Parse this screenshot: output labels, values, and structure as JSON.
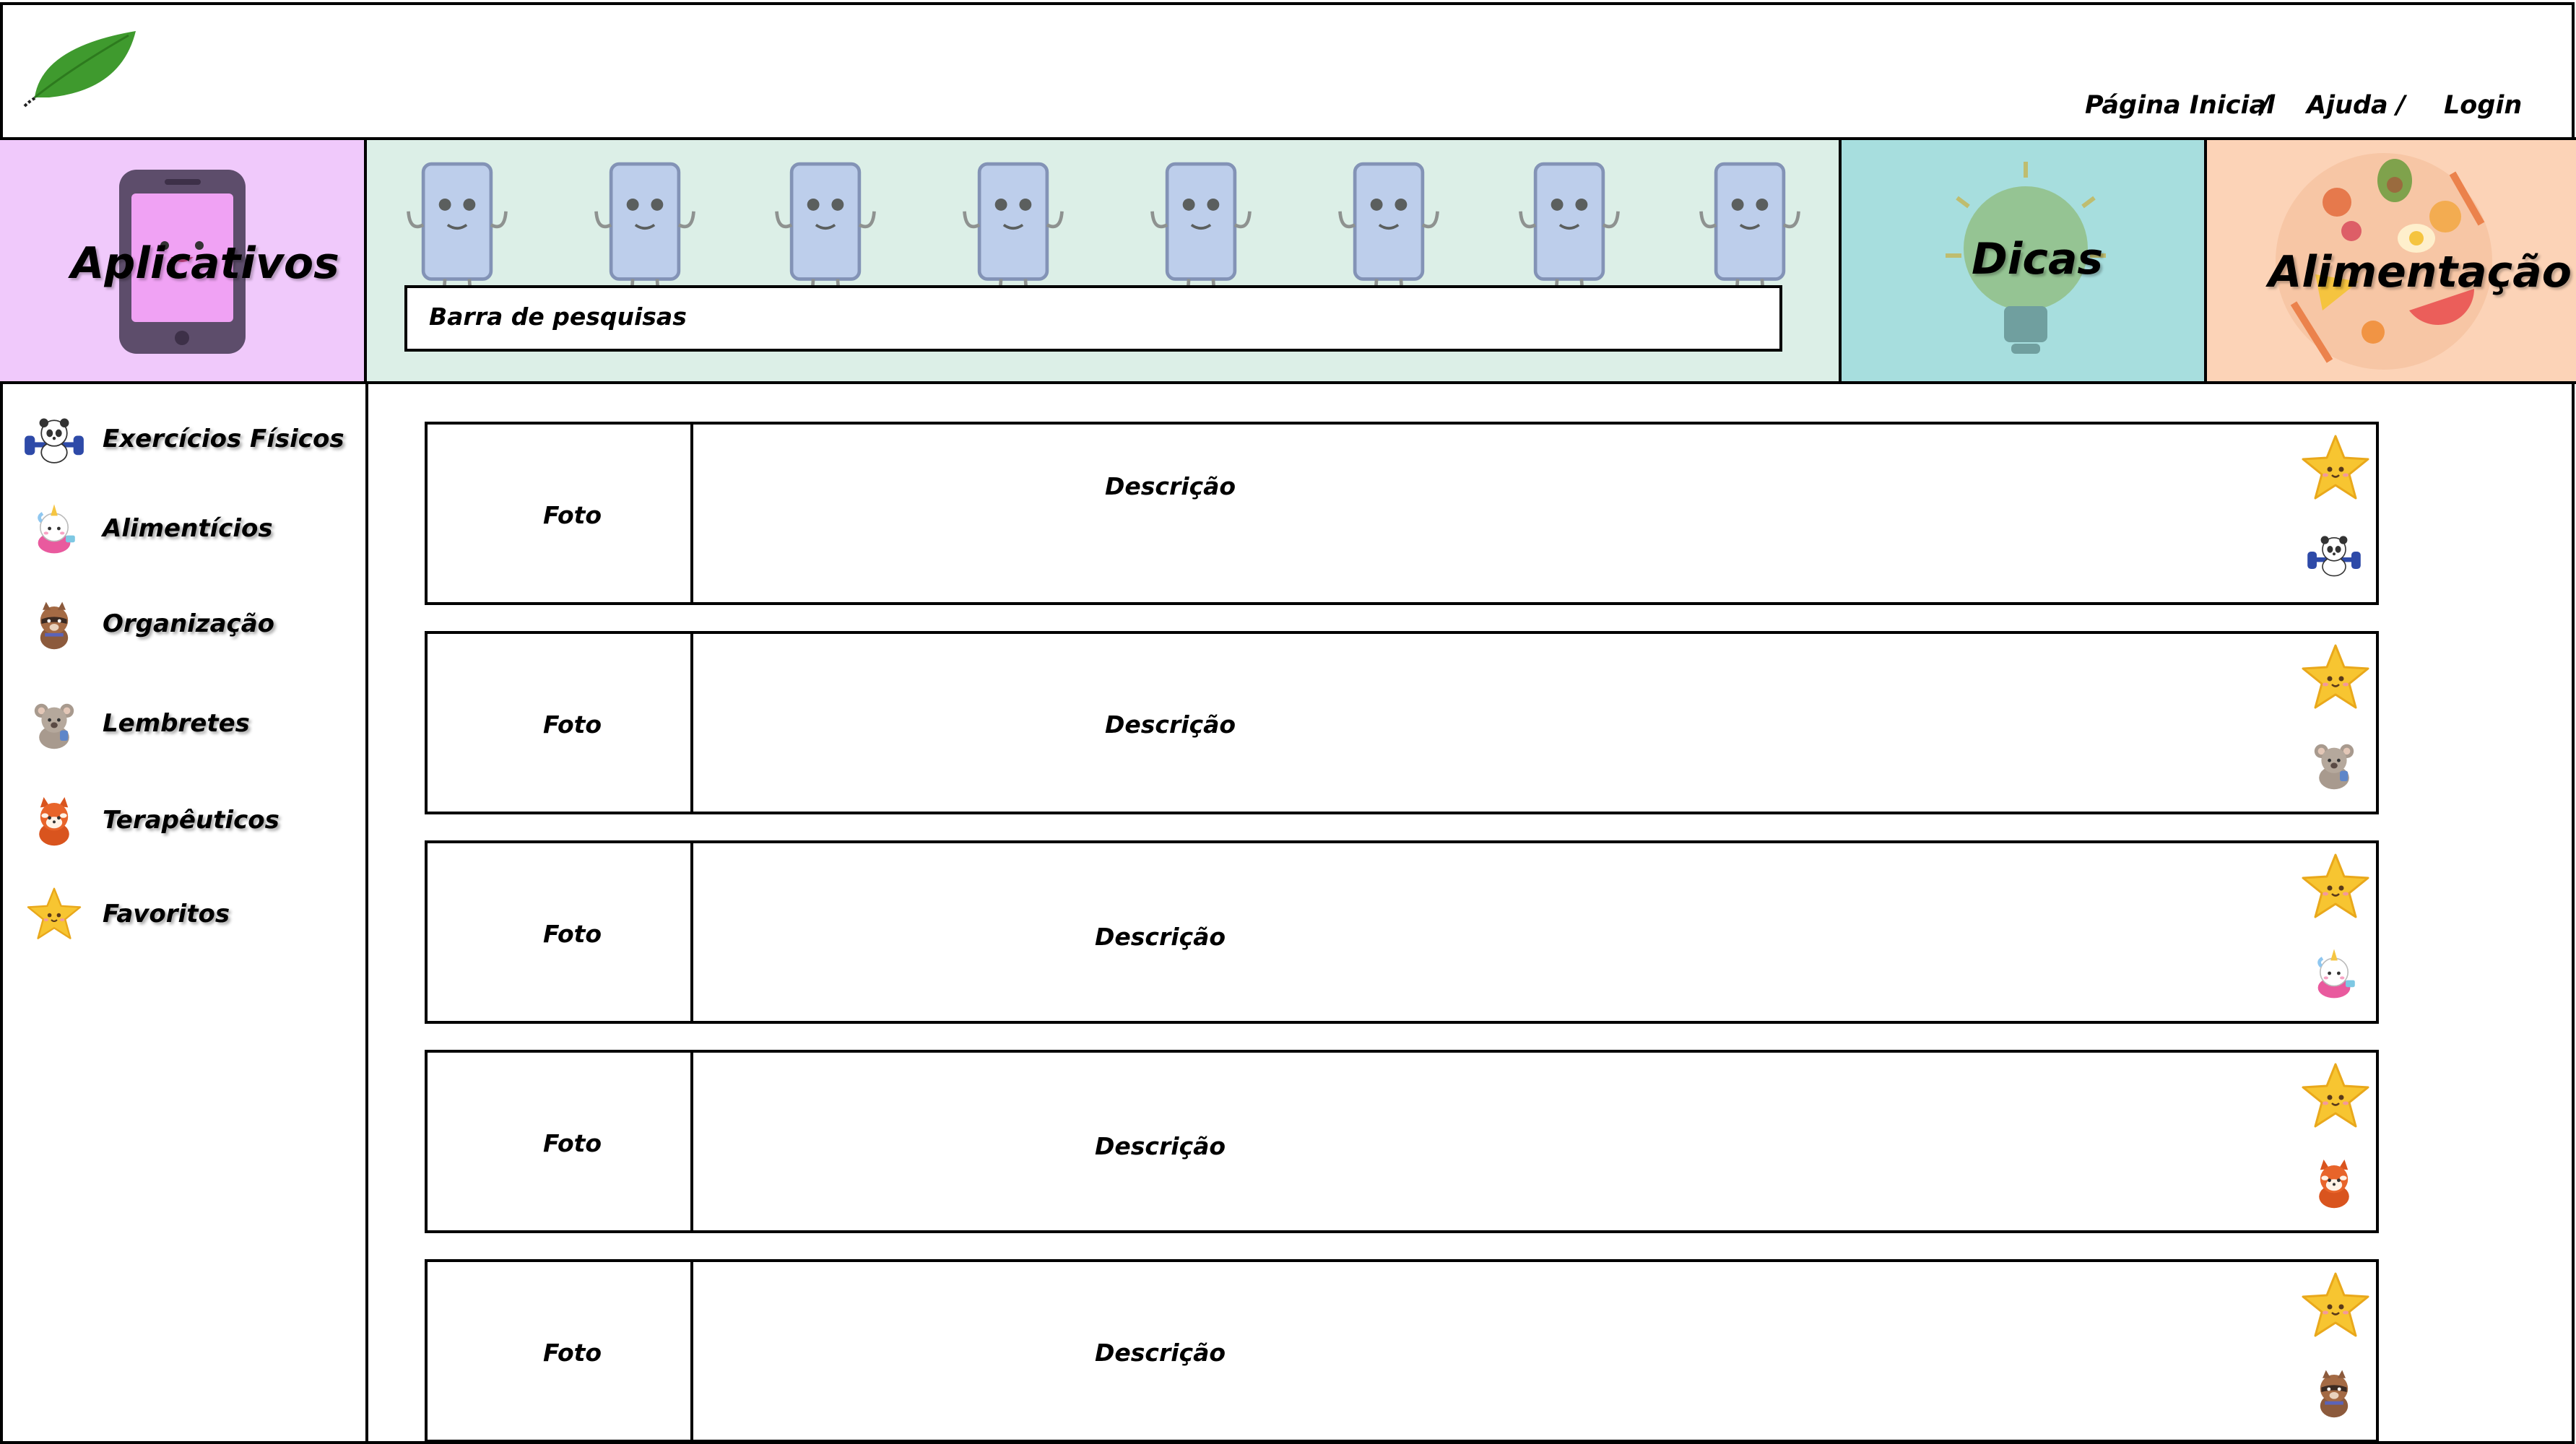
{
  "header": {
    "logo_icon": "leaf-icon",
    "nav": {
      "home": "Página Inicial",
      "sep1": "/",
      "help": "Ajuda",
      "sep2": "/",
      "login": "Login"
    }
  },
  "tiles": {
    "apps": {
      "label": "Aplicativos",
      "icon": "smartphone-icon",
      "color": "#f0c9fb"
    },
    "banner": {
      "color": "#dcefe7"
    },
    "dicas": {
      "label": "Dicas",
      "icon": "lightbulb-icon",
      "color": "#a7dede"
    },
    "food": {
      "label": "Alimentação",
      "icon": "food-icon",
      "color": "#fcd3b7"
    }
  },
  "search": {
    "placeholder": "Barra de pesquisas"
  },
  "sidebar": {
    "items": [
      {
        "label": "Exercícios Físicos",
        "icon": "panda-dumbbell-icon"
      },
      {
        "label": "Alimentícios",
        "icon": "unicorn-icon"
      },
      {
        "label": "Organização",
        "icon": "raccoon-icon"
      },
      {
        "label": "Lembretes",
        "icon": "koala-icon"
      },
      {
        "label": "Terapêuticos",
        "icon": "red-panda-icon"
      },
      {
        "label": "Favoritos",
        "icon": "star-icon"
      }
    ]
  },
  "cards": [
    {
      "photo": "Foto",
      "description": "Descrição",
      "category_icon": "panda-dumbbell-icon"
    },
    {
      "photo": "Foto",
      "description": "Descrição",
      "category_icon": "koala-icon"
    },
    {
      "photo": "Foto",
      "description": "Descrição",
      "category_icon": "unicorn-icon"
    },
    {
      "photo": "Foto",
      "description": "Descrição",
      "category_icon": "red-panda-icon"
    },
    {
      "photo": "Foto",
      "description": "Descrição",
      "category_icon": "raccoon-icon"
    }
  ]
}
